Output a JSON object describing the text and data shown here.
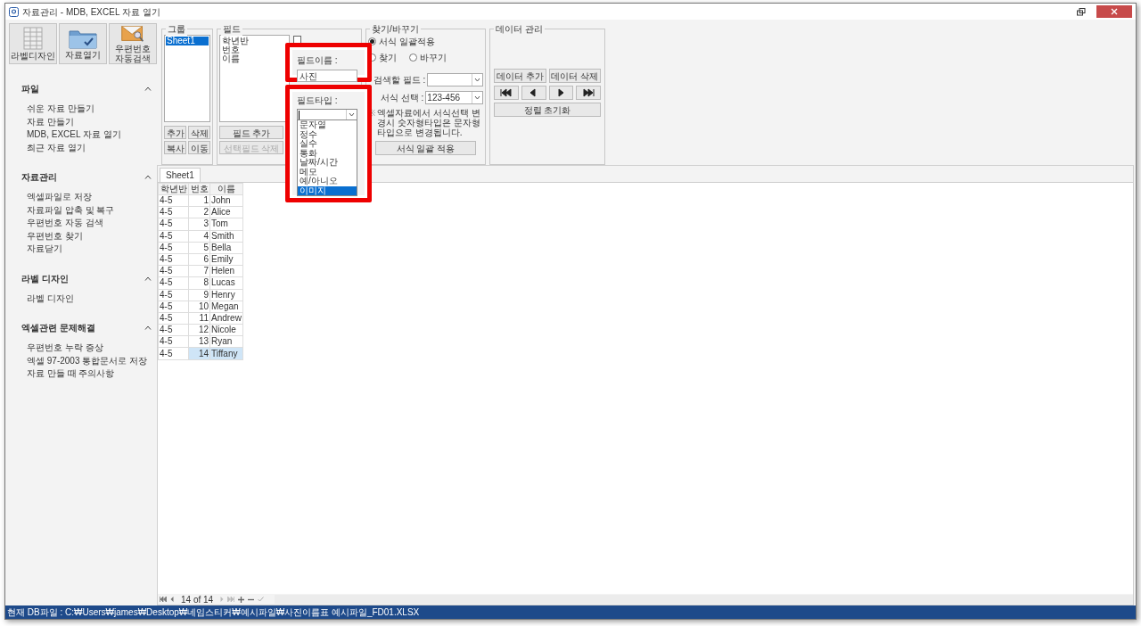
{
  "window": {
    "title": "자료관리 - MDB, EXCEL 자료 열기"
  },
  "toolbar": [
    {
      "label": "라벨디자인",
      "kind": "grid"
    },
    {
      "label": "자료열기",
      "kind": "folder"
    },
    {
      "label": "우편번호\n자동검색",
      "kind": "mail"
    }
  ],
  "sidebar": {
    "sections": [
      {
        "title": "파일",
        "expanded": true,
        "items": [
          "쉬운 자료 만들기",
          "자료 만들기",
          "MDB, EXCEL 자료 열기",
          "최근 자료 열기"
        ]
      },
      {
        "title": "자료관리",
        "expanded": true,
        "items": [
          "엑셀파일로 저장",
          "자료파일 압축 및 복구",
          "우편번호 자동 검색",
          "우편번호 찾기",
          "자료닫기"
        ]
      },
      {
        "title": "라벨 디자인",
        "expanded": true,
        "items": [
          "라벨 디자인"
        ]
      },
      {
        "title": "엑셀관련 문제해결",
        "expanded": true,
        "items": [
          "우편번호 누락 증상",
          "엑셀 97-2003 통합문서로 저장",
          "자료 만들 때 주의사항"
        ]
      }
    ]
  },
  "group_panel": {
    "title": "그룹",
    "items": [
      {
        "label": "Sheet1",
        "selected": true
      }
    ],
    "buttons": [
      "추가",
      "삭제",
      "복사",
      "이동"
    ]
  },
  "field_panel": {
    "title": "필드",
    "items": [
      {
        "label": "학년반",
        "selected": false
      },
      {
        "label": "번호",
        "selected": false
      },
      {
        "label": "이름",
        "selected": false
      }
    ],
    "checkbox": {
      "checked": false
    },
    "buttons": [
      {
        "label": "필드 추가",
        "disabled": false
      },
      {
        "label": "선택필드 삭제",
        "disabled": true
      }
    ]
  },
  "find_replace": {
    "title": "찾기/바꾸기",
    "modes": [
      {
        "label": "서식 일괄적용",
        "selected": true
      },
      {
        "label": "찾기",
        "selected": false
      },
      {
        "label": "바꾸기",
        "selected": false
      }
    ],
    "search_field_label": "검색할 필드 :",
    "format_label": "서식 선택 :",
    "format_value": "123-456",
    "note_mark": "※",
    "note": "엑셀자료에서 서식선택 변경시 숫자형타입은 문자형타입으로 변경됩니다.",
    "apply_button": "서식 일괄 적용"
  },
  "data_panel": {
    "title": "데이터 관리",
    "buttons": [
      "데이터 추가",
      "데이터 삭제"
    ],
    "reset_button": "정렬 초기화"
  },
  "field_name_popup": {
    "label": "필드이름 :",
    "value": "사진"
  },
  "field_type_popup": {
    "label": "필드타입 :",
    "options": [
      {
        "label": "문자열",
        "selected": false
      },
      {
        "label": "정수",
        "selected": false
      },
      {
        "label": "실수",
        "selected": false
      },
      {
        "label": "통화",
        "selected": false
      },
      {
        "label": "날짜/시간",
        "selected": false
      },
      {
        "label": "메모",
        "selected": false
      },
      {
        "label": "예/아니오",
        "selected": false
      },
      {
        "label": "이미지",
        "selected": true
      }
    ]
  },
  "sheet_tabs": [
    {
      "label": "Sheet1",
      "selected": true
    }
  ],
  "table": {
    "columns": [
      "학년반",
      "번호",
      "이름"
    ],
    "rows": [
      {
        "cells": [
          "4-5",
          "1",
          "John"
        ],
        "selected": false
      },
      {
        "cells": [
          "4-5",
          "2",
          "Alice"
        ],
        "selected": false
      },
      {
        "cells": [
          "4-5",
          "3",
          "Tom"
        ],
        "selected": false
      },
      {
        "cells": [
          "4-5",
          "4",
          "Smith"
        ],
        "selected": false
      },
      {
        "cells": [
          "4-5",
          "5",
          "Bella"
        ],
        "selected": false
      },
      {
        "cells": [
          "4-5",
          "6",
          "Emily"
        ],
        "selected": false
      },
      {
        "cells": [
          "4-5",
          "7",
          "Helen"
        ],
        "selected": false
      },
      {
        "cells": [
          "4-5",
          "8",
          "Lucas"
        ],
        "selected": false
      },
      {
        "cells": [
          "4-5",
          "9",
          "Henry"
        ],
        "selected": false
      },
      {
        "cells": [
          "4-5",
          "10",
          "Megan"
        ],
        "selected": false
      },
      {
        "cells": [
          "4-5",
          "11",
          "Andrew"
        ],
        "selected": false
      },
      {
        "cells": [
          "4-5",
          "12",
          "Nicole"
        ],
        "selected": false
      },
      {
        "cells": [
          "4-5",
          "13",
          "Ryan"
        ],
        "selected": false
      },
      {
        "cells": [
          "4-5",
          "14",
          "Tiffany"
        ],
        "selected": true
      }
    ]
  },
  "navigator": {
    "position": "14 of 14"
  },
  "status_bar": {
    "text": "현재 DB파일 : C:₩Users₩james₩Desktop₩네임스티커₩예시파일₩사진이름표 예시파일_FD01.XLSX"
  }
}
